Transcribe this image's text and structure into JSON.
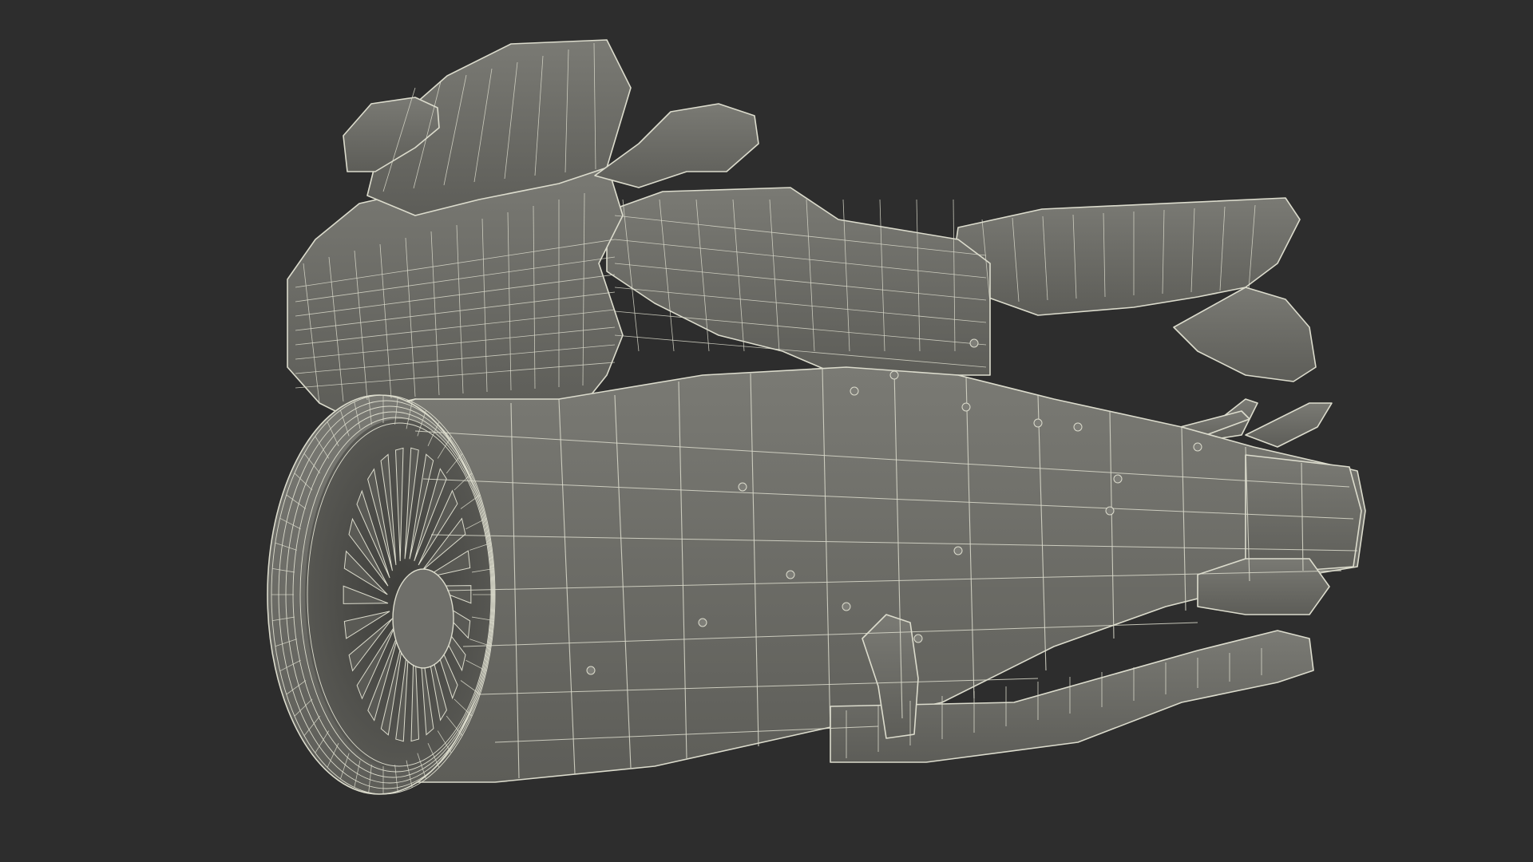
{
  "scene": {
    "background_color": "#2d2d2d",
    "surface_color": "#6f6f6a",
    "surface_shadow_color": "#5a5a55",
    "surface_highlight_color": "#7e7e78",
    "wire_color": "#dcdccd",
    "subject_icon": "jet-motorcycle-wireframe-model"
  }
}
